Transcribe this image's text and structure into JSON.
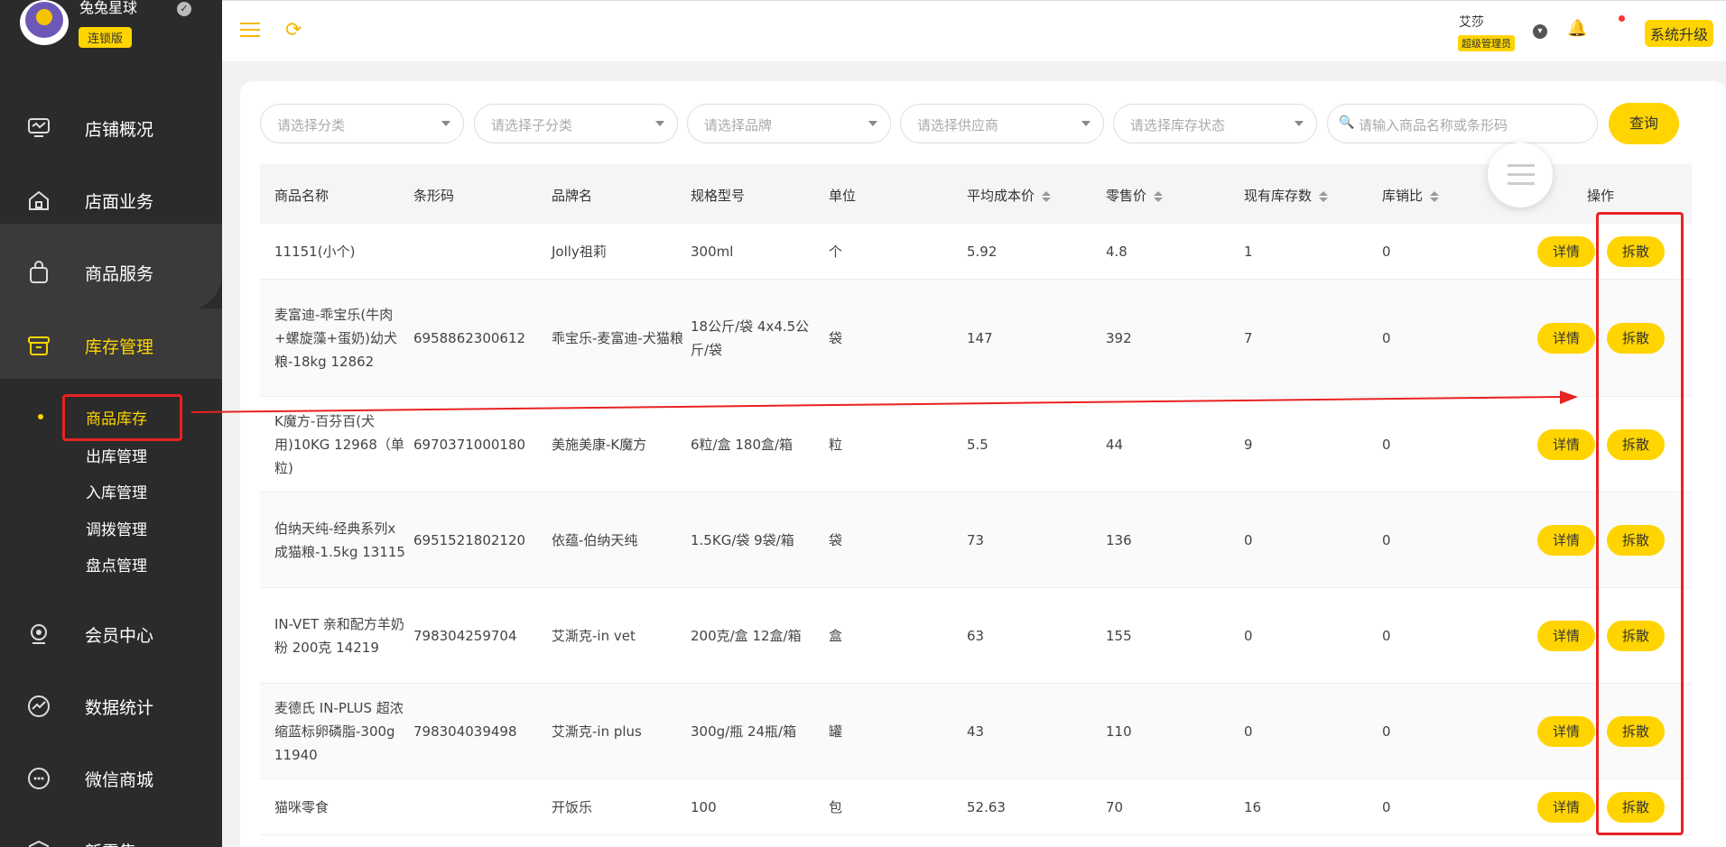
{
  "brand": {
    "name": "兔兔星球",
    "edition": "连锁版"
  },
  "nav": [
    {
      "label": "店铺概况",
      "icon": "monitor-icon"
    },
    {
      "label": "店面业务",
      "icon": "home-icon"
    },
    {
      "label": "商品服务",
      "icon": "bag-icon"
    },
    {
      "label": "库存管理",
      "icon": "box-icon"
    },
    {
      "label": "会员中心",
      "icon": "user-icon"
    },
    {
      "label": "数据统计",
      "icon": "chart-icon"
    },
    {
      "label": "微信商城",
      "icon": "chat-icon"
    },
    {
      "label": "新零售",
      "icon": "cube-icon"
    }
  ],
  "subnav": [
    "商品库存",
    "出库管理",
    "入库管理",
    "调拨管理",
    "盘点管理"
  ],
  "header": {
    "user_name": "艾莎",
    "user_role": "超级管理员",
    "upgrade_label": "系统升级"
  },
  "filters": {
    "category": "请选择分类",
    "subcategory": "请选择子分类",
    "brand": "请选择品牌",
    "supplier": "请选择供应商",
    "stock_status": "请选择库存状态",
    "search_placeholder": "请输入商品名称或条形码",
    "query_label": "查询"
  },
  "table": {
    "columns": [
      "商品名称",
      "条形码",
      "品牌名",
      "规格型号",
      "单位",
      "平均成本价",
      "零售价",
      "现有库存数",
      "库销比",
      "操作"
    ],
    "detail_label": "详情",
    "split_label": "拆散",
    "rows": [
      {
        "name": "11151(小个)",
        "barcode": "",
        "brand": "Jolly祖莉",
        "spec": "300ml",
        "unit": "个",
        "cost": "5.92",
        "price": "4.8",
        "stock": "1",
        "ratio": "0"
      },
      {
        "name": "麦富迪-乖宝乐(牛肉+螺旋藻+蛋奶)幼犬粮-18kg 12862",
        "barcode": "6958862300612",
        "brand": "乖宝乐-麦富迪-犬猫粮",
        "spec": "18公斤/袋 4x4.5公斤/袋",
        "unit": "袋",
        "cost": "147",
        "price": "392",
        "stock": "7",
        "ratio": "0"
      },
      {
        "name": "K魔方-百芬百(犬用)10KG 12968（单粒)",
        "barcode": "6970371000180",
        "brand": "美施美康-K魔方",
        "spec": "6粒/盒 180盒/箱",
        "unit": "粒",
        "cost": "5.5",
        "price": "44",
        "stock": "9",
        "ratio": "0"
      },
      {
        "name": "伯纳天纯-经典系列x成猫粮-1.5kg 13115",
        "barcode": "6951521802120",
        "brand": "依蕴-伯纳天纯",
        "spec": "1.5KG/袋 9袋/箱",
        "unit": "袋",
        "cost": "73",
        "price": "136",
        "stock": "0",
        "ratio": "0"
      },
      {
        "name": "IN-VET 亲和配方羊奶粉 200克 14219",
        "barcode": "798304259704",
        "brand": "艾澌克-in vet",
        "spec": "200克/盒 12盒/箱",
        "unit": "盒",
        "cost": "63",
        "price": "155",
        "stock": "0",
        "ratio": "0"
      },
      {
        "name": "麦德氏 IN-PLUS 超浓缩蓝标卵磷脂-300g 11940",
        "barcode": "798304039498",
        "brand": "艾澌克-in plus",
        "spec": "300g/瓶 24瓶/箱",
        "unit": "罐",
        "cost": "43",
        "price": "110",
        "stock": "0",
        "ratio": "0"
      },
      {
        "name": "猫咪零食",
        "barcode": "",
        "brand": "开饭乐",
        "spec": "100",
        "unit": "包",
        "cost": "52.63",
        "price": "70",
        "stock": "16",
        "ratio": "0"
      }
    ]
  },
  "colors": {
    "accent": "#ffd400",
    "sidebar": "#2b2b2b",
    "annotation": "#e82222"
  }
}
